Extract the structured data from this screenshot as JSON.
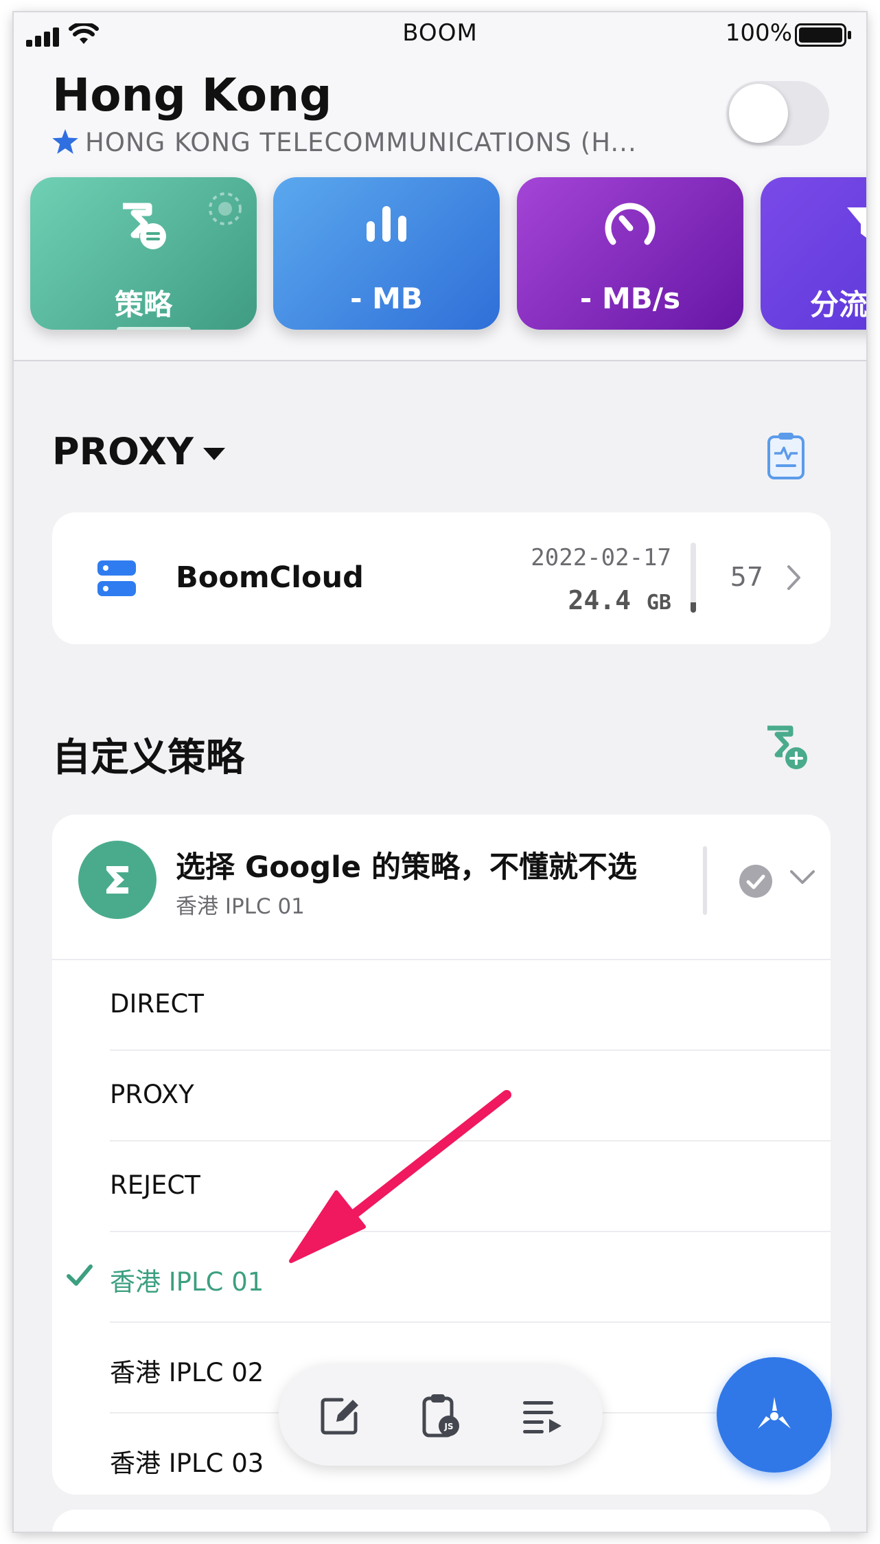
{
  "status_bar": {
    "app_name": "BOOM",
    "battery_percent": "100%"
  },
  "header": {
    "location": "Hong Kong",
    "isp": "HONG KONG TELECOMMUNICATIONS (H...",
    "vpn_enabled": false
  },
  "cards": [
    {
      "label": "策略",
      "icon": "policy-sigma-icon",
      "color": "#4aab8c"
    },
    {
      "label": "- MB",
      "icon": "bar-chart-icon",
      "color": "#3f86e4"
    },
    {
      "label": "- MB/s",
      "icon": "speedometer-icon",
      "color": "#8a2fc2"
    },
    {
      "label": "分流",
      "icon": "filter-icon",
      "color": "#6a3fe0"
    }
  ],
  "group": {
    "name": "PROXY"
  },
  "subscription": {
    "name": "BoomCloud",
    "expires": "2022-02-17",
    "usage": "24.4",
    "usage_unit": "GB",
    "usage_fraction": 0.15,
    "node_count": "57"
  },
  "custom_section": {
    "title": "自定义策略"
  },
  "policy": {
    "avatar_icon": "sigma-icon",
    "title": "选择 Google 的策略，不懂就不选",
    "selected": "香港 IPLC 01",
    "options": [
      "DIRECT",
      "PROXY",
      "REJECT",
      "香港 IPLC 01",
      "香港 IPLC 02",
      "香港 IPLC 03"
    ],
    "selected_index": 3
  },
  "colors": {
    "accent_green": "#4aab8c",
    "primary_blue": "#3078e8",
    "annotation_pink": "#f0185e"
  },
  "toolbar": {
    "items": [
      "edit-icon",
      "js-clipboard-icon",
      "playlist-icon"
    ]
  }
}
